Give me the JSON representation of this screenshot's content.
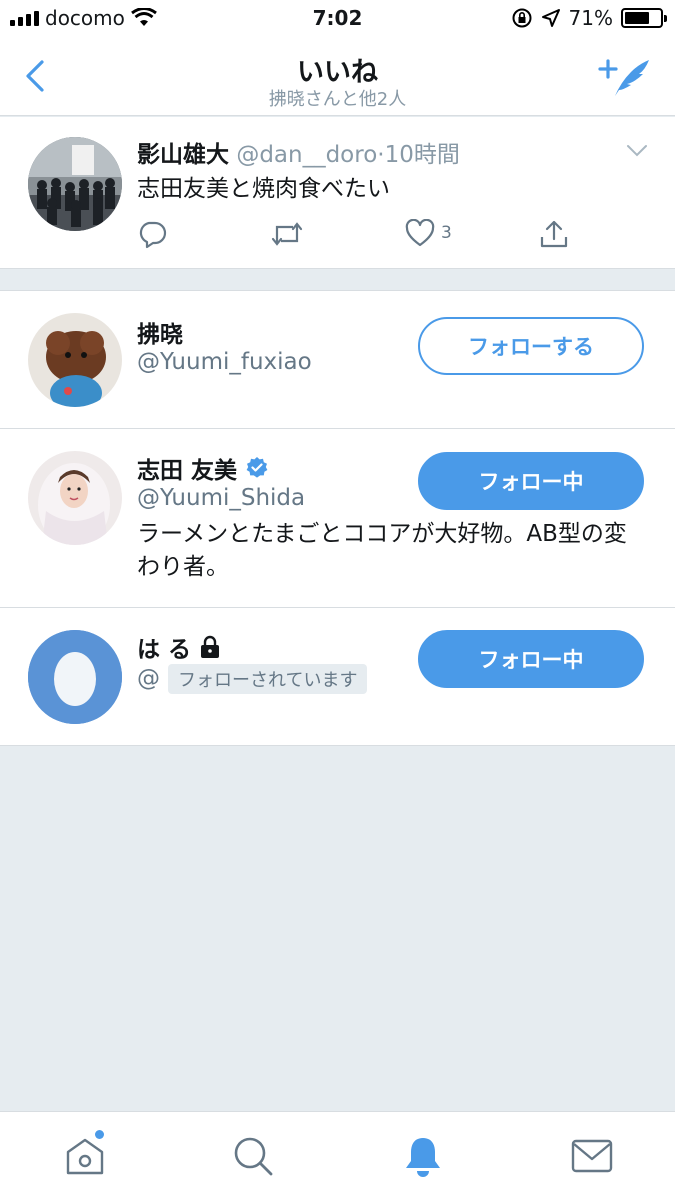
{
  "status_bar": {
    "carrier": "docomo",
    "time": "7:02",
    "battery_percent": "71%",
    "battery_level": 0.71
  },
  "nav": {
    "title": "いいね",
    "subtitle": "拂晓さんと他2人"
  },
  "tweet": {
    "name": "影山雄大",
    "handle": "@dan__doro",
    "time": "·10時間",
    "text": "志田友美と焼肉食べたい",
    "like_count": "3"
  },
  "users": [
    {
      "name": "拂晓",
      "handle": "@Yuumi_fuxiao",
      "button": "フォローする"
    },
    {
      "name": "志田 友美",
      "handle": "@Yuumi_Shida",
      "verified": true,
      "bio": "ラーメンとたまごとココアが大好物。AB型の変わり者。",
      "button": "フォロー中"
    },
    {
      "name": "は る",
      "handle": "@",
      "protected": true,
      "follows_you": "フォローされています",
      "button": "フォロー中"
    }
  ],
  "colors": {
    "accent": "#4a9ae8",
    "background": "#e6ecf0",
    "muted_text": "#8899a6"
  },
  "icons": {
    "back": "chevron-left-icon",
    "compose": "compose-tweet-icon",
    "tabs": [
      "home-icon",
      "search-icon",
      "notifications-icon",
      "messages-icon"
    ]
  }
}
